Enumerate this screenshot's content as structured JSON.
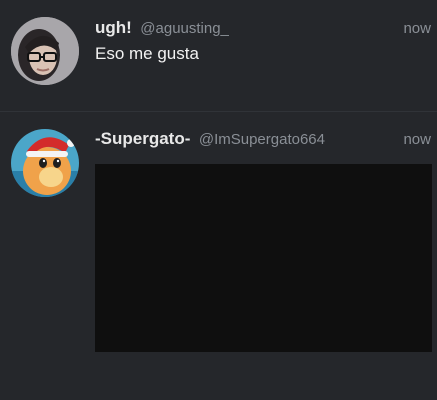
{
  "tweets": [
    {
      "display_name": "ugh!",
      "handle": "@aguusting_",
      "time": "now",
      "text": "Eso me gusta",
      "avatar_icon": "user-avatar-photo"
    },
    {
      "display_name": "-Supergato-",
      "handle": "@ImSupergato664",
      "time": "now",
      "text": "",
      "avatar_icon": "cartoon-character-avatar",
      "media": "embedded-video-dark"
    }
  ],
  "colors": {
    "background": "#25272b",
    "name": "#e8e8e8",
    "meta": "#8a8f96",
    "media": "#0f0f0f"
  }
}
